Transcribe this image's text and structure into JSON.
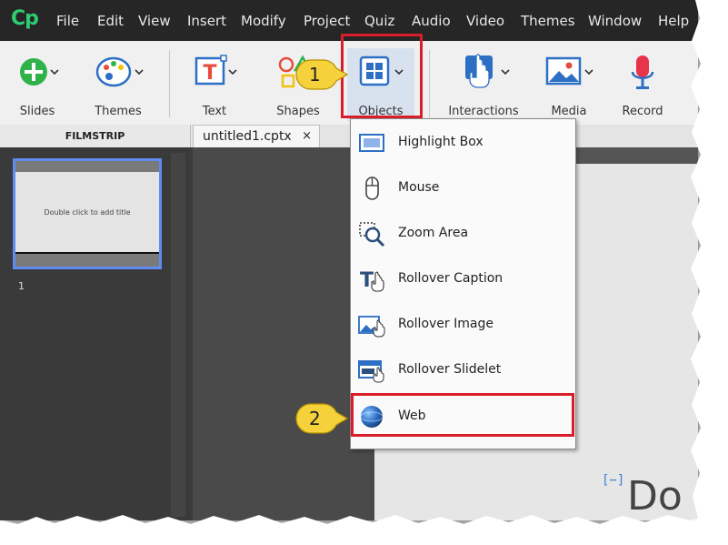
{
  "app": {
    "logo": "Cp"
  },
  "menubar": {
    "items": [
      "File",
      "Edit",
      "View",
      "Insert",
      "Modify",
      "Project",
      "Quiz",
      "Audio",
      "Video",
      "Themes",
      "Window",
      "Help"
    ]
  },
  "toolbar": {
    "slides_label": "Slides",
    "themes_label": "Themes",
    "text_label": "Text",
    "shapes_label": "Shapes",
    "objects_label": "Objects",
    "interactions_label": "Interactions",
    "media_label": "Media",
    "record_label": "Record"
  },
  "tabs": {
    "filmstrip_label": "FILMSTRIP",
    "document_tab": "untitled1.cptx",
    "close_glyph": "×"
  },
  "filmstrip": {
    "slide_placeholder": "Double click to add title",
    "slide_number": "1"
  },
  "objects_menu": {
    "items": [
      {
        "label": "Highlight Box",
        "icon": "highlight-box-icon"
      },
      {
        "label": "Mouse",
        "icon": "mouse-icon"
      },
      {
        "label": "Zoom Area",
        "icon": "zoom-area-icon"
      },
      {
        "label": "Rollover Caption",
        "icon": "rollover-caption-icon"
      },
      {
        "label": "Rollover Image",
        "icon": "rollover-image-icon"
      },
      {
        "label": "Rollover Slidelet",
        "icon": "rollover-slidelet-icon"
      },
      {
        "label": "Web",
        "icon": "web-globe-icon"
      }
    ]
  },
  "annotations": {
    "step1": "1",
    "step2": "2",
    "highlight_color": "#d91e2a",
    "callout_color": "#f5d23c"
  },
  "stage": {
    "partial_text": "Do"
  },
  "colors": {
    "accent_green": "#2ecc71",
    "selection_blue": "#5e8cf0"
  }
}
